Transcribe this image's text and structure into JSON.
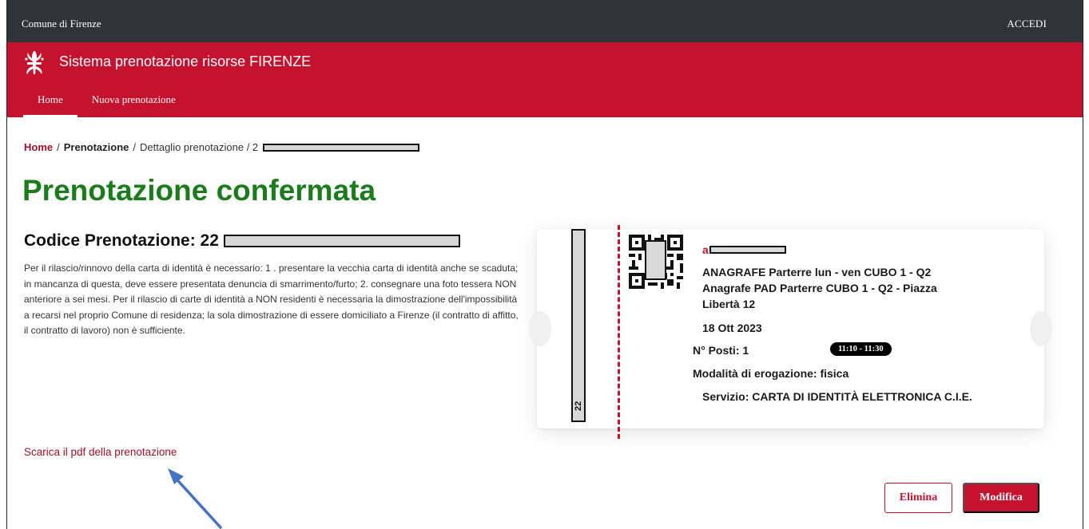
{
  "topbar": {
    "org_name": "Comune di Firenze",
    "login_label": "ACCEDI"
  },
  "header": {
    "title": "Sistema prenotazione risorse FIRENZE",
    "nav": [
      {
        "label": "Home"
      },
      {
        "label": "Nuova prenotazione"
      }
    ]
  },
  "breadcrumb": {
    "home": "Home",
    "sep": "/",
    "level2": "Prenotazione",
    "level3": "Dettaglio prenotazione / 2"
  },
  "page": {
    "title": "Prenotazione confermata",
    "code_label": "Codice Prenotazione: 22",
    "note": "Per il rilascio/rinnovo della carta di identità è necessario: 1 . presentare la vecchia carta di identità anche se scaduta; in mancanza di questa, deve essere presentata denuncia di smarrimento/furto; 2. consegnare una foto tessera NON anteriore a sei mesi. Per il rilascio di carte di identità a NON residenti è necessaria la dimostrazione dell'impossibilità a recarsi nel proprio Comune di residenza; la sola dimostrazione di essere domiciliato a Firenze (il contratto di affitto, il contratto di lavoro) non è sufficiente.",
    "pdf_link": "Scarica il pdf della prenotazione"
  },
  "ticket": {
    "stub_code": "22",
    "name_initial": "a",
    "location": "ANAGRAFE Parterre lun - ven CUBO 1 - Q2 Anagrafe PAD Parterre CUBO 1 - Q2 - Piazza Libertà 12",
    "date": "18 Ott 2023",
    "seats": "N° Posti: 1",
    "time_slot": "11:10 - 11:30",
    "mode": "Modalità di erogazione: fisica",
    "service": "Servizio: CARTA DI IDENTITÀ ELETTRONICA C.I.E."
  },
  "actions": {
    "delete_label": "Elimina",
    "edit_label": "Modifica"
  },
  "colors": {
    "brand_red": "#c4122f",
    "topbar": "#2f3438",
    "title_green": "#1a7c1a",
    "arrow_blue": "#4472c4"
  }
}
